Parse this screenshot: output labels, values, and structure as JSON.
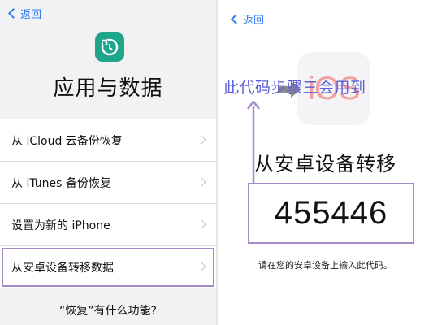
{
  "left_screen": {
    "back_label": "返回",
    "icon": "restore-icon",
    "title": "应用与数据",
    "options": [
      {
        "label": "从 iCloud 云备份恢复"
      },
      {
        "label": "从 iTunes 备份恢复"
      },
      {
        "label": "设置为新的 iPhone"
      },
      {
        "label": "从安卓设备转移数据",
        "highlighted": true
      }
    ],
    "help_link": "“恢复”有什么功能?"
  },
  "right_screen": {
    "back_label": "返回",
    "ios_logo_text": "iOS",
    "annotation": "此代码步骤三会用到",
    "title": "从安卓设备转移",
    "code": "455446",
    "hint": "请在您的安卓设备上输入此代码。"
  },
  "colors": {
    "ios_blue": "#2f7bf5",
    "highlight_border": "#a58cc8",
    "annotation_text": "#5d5fd8",
    "icon_green": "#1fa58a"
  }
}
